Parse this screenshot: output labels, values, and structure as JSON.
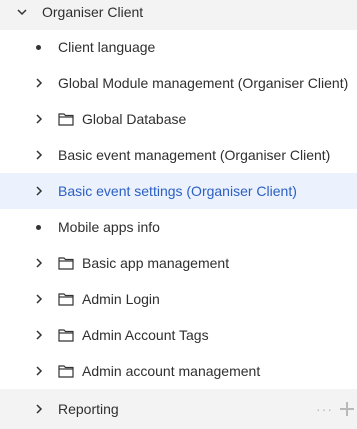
{
  "tree": {
    "root": {
      "label": "Organiser Client"
    },
    "items": [
      {
        "label": "Client language",
        "kind": "leaf"
      },
      {
        "label": "Global Module management (Organiser Client)",
        "kind": "collapsed"
      },
      {
        "label": "Global Database",
        "kind": "folder"
      },
      {
        "label": "Basic event management (Organiser Client)",
        "kind": "collapsed"
      },
      {
        "label": "Basic event settings (Organiser Client)",
        "kind": "collapsed",
        "selected": true
      },
      {
        "label": "Mobile apps info",
        "kind": "leaf"
      },
      {
        "label": "Basic app management",
        "kind": "folder"
      },
      {
        "label": "Admin Login",
        "kind": "folder"
      },
      {
        "label": "Admin Account Tags",
        "kind": "folder"
      },
      {
        "label": "Admin account management",
        "kind": "folder"
      }
    ],
    "footer": {
      "label": "Reporting",
      "more": "···"
    }
  },
  "colors": {
    "header_bg": "#f3f3f3",
    "selected_bg": "#ebf1fd",
    "selected_text": "#2b5fc2",
    "text": "#2f2f2f"
  }
}
